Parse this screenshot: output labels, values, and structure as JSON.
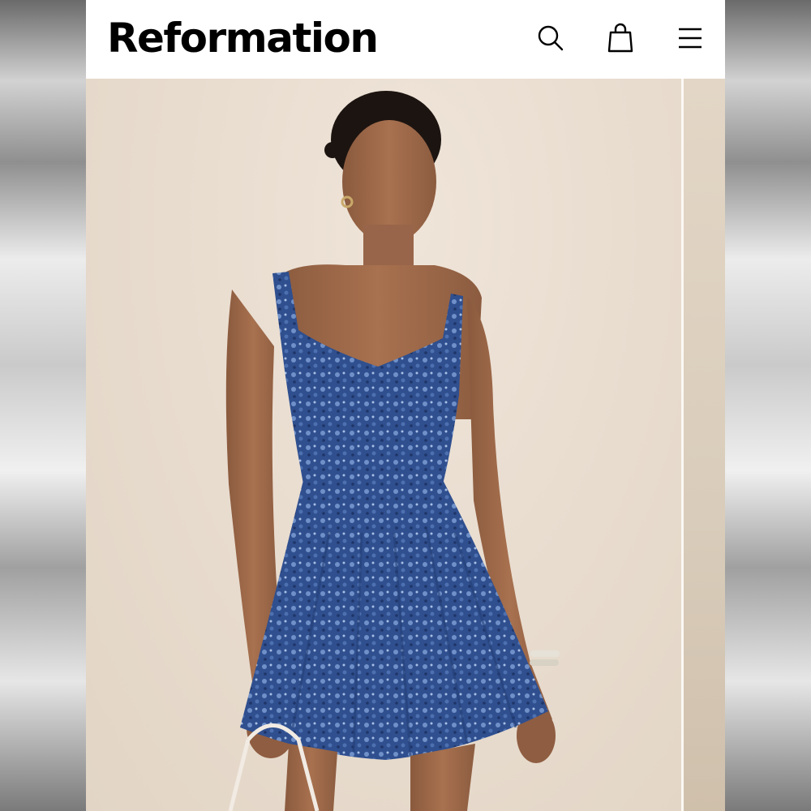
{
  "header": {
    "logo": "Reformation",
    "icons": {
      "search": "search-icon",
      "bag": "shopping-bag-icon",
      "menu": "hamburger-menu-icon"
    }
  },
  "gallery": {
    "current_image": "product-photo-blue-floral-mini-dress",
    "next_image_peek": "product-photo-next"
  },
  "colors": {
    "background": "#ffffff",
    "text": "#000000",
    "photo_backdrop": "#e9ddd0",
    "dress": "#2f4f8f"
  }
}
